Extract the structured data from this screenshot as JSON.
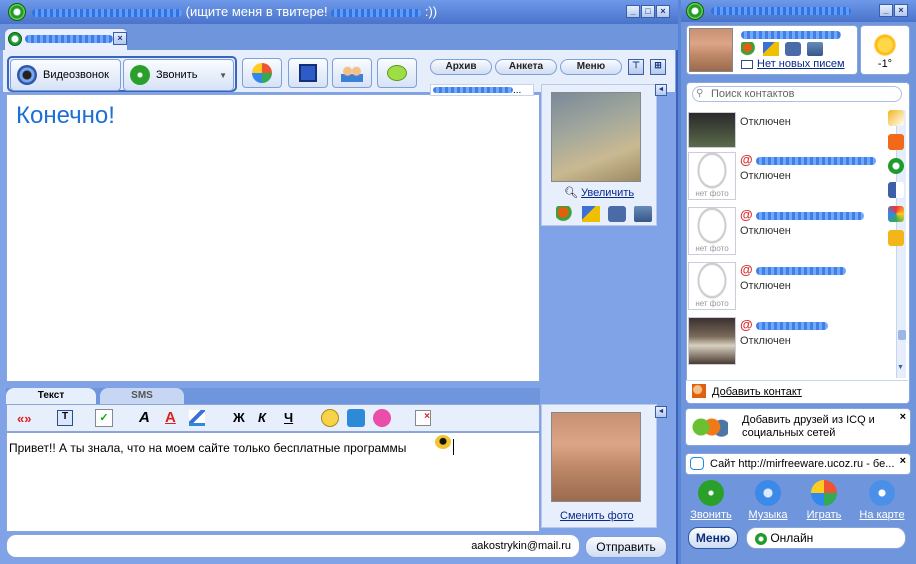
{
  "chat": {
    "title_suffix": "(ищите меня в твитере!",
    "title_end": ":))",
    "toolbar": {
      "video_call": "Видеозвонок",
      "call": "Звонить",
      "archive": "Архив",
      "profile": "Анкета",
      "menu": "Меню"
    },
    "contact_link_suffix": "...",
    "message_big": "Конечно!",
    "zoom_link": "Увеличить",
    "input_tabs": [
      "Текст",
      "SMS"
    ],
    "format": {
      "bold": "Ж",
      "italic": "К",
      "underline": "Ч",
      "quote": "«»"
    },
    "draft": "Привет!! А ты знала, что на моем сайте только бесплатные программы",
    "change_photo": "Сменить фото",
    "sender": "aakostrykin@mail.ru",
    "send": "Отправить"
  },
  "contacts": {
    "no_mail": "Нет новых писем",
    "temperature": "-1°",
    "search_placeholder": "Поиск контактов",
    "status_offline": "Отключен",
    "no_photo": "нет фото",
    "add_contact": "Добавить контакт",
    "promo": "Добавить друзей из ICQ и социальных сетей",
    "ticker": "Сайт http://mirfreeware.ucoz.ru - бе...",
    "quick": [
      "Звонить",
      "Музыка",
      "Играть",
      "На карте"
    ],
    "menu": "Меню",
    "status": "Онлайн",
    "rows": [
      {
        "photo": "person",
        "name_visible": false
      },
      {
        "photo": "none",
        "name_visible": true
      },
      {
        "photo": "none",
        "name_visible": true
      },
      {
        "photo": "none",
        "name_visible": true
      },
      {
        "photo": "person",
        "name_visible": true
      }
    ]
  }
}
